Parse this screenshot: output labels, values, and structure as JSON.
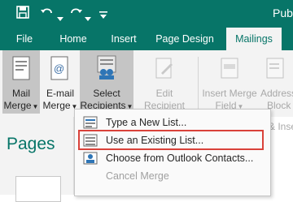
{
  "titlebar": {
    "doc_title": "Publ",
    "icons": [
      "save-icon",
      "undo-icon",
      "redo-icon",
      "customize-qat-icon"
    ]
  },
  "tabs": [
    {
      "label": "File",
      "active": false
    },
    {
      "label": "Home",
      "active": false
    },
    {
      "label": "Insert",
      "active": false
    },
    {
      "label": "Page Design",
      "active": false
    },
    {
      "label": "Mailings",
      "active": true
    }
  ],
  "ribbon": {
    "mail_merge": {
      "line1": "Mail",
      "line2": "Merge"
    },
    "email_merge": {
      "line1": "E-mail",
      "line2": "Merge"
    },
    "select_recipients": {
      "line1": "Select",
      "line2": "Recipients"
    },
    "edit_recipient_list": {
      "line1": "Edit",
      "line2": "Recipient List"
    },
    "insert_merge_field": {
      "line1": "Insert Merge",
      "line2": "Field"
    },
    "address_block": {
      "line1": "Address",
      "line2": "Block"
    },
    "partial_label": "& Inse"
  },
  "nav_pane": {
    "title": "Pages"
  },
  "dropdown": {
    "items": [
      {
        "label": "Type a New List...",
        "disabled": false
      },
      {
        "label": "Use an Existing List...",
        "disabled": false,
        "highlighted": true
      },
      {
        "label": "Choose from Outlook Contacts...",
        "disabled": false
      },
      {
        "label": "Cancel Merge",
        "disabled": true
      }
    ]
  },
  "colors": {
    "accent": "#077568",
    "highlight_border": "#d9423a",
    "selected_button": "#c5c5c5"
  }
}
